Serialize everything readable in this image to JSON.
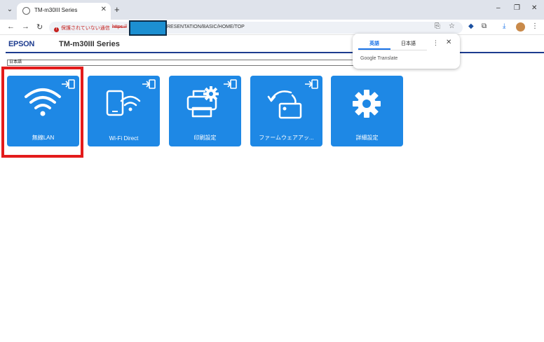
{
  "browser": {
    "tab_title": "TM-m30III Series",
    "security_label": "保護されていない通信",
    "url_protocol": "https://",
    "url_visible": "RESENTATION/BASIC/HOME/TOP",
    "tab_menu_glyph": "⌄",
    "new_tab_glyph": "+",
    "close_glyph": "✕",
    "minimize_glyph": "–",
    "maximize_glyph": "❐",
    "back_glyph": "←",
    "forward_glyph": "→",
    "reload_glyph": "↻",
    "translate_glyph": "⎘",
    "star_glyph": "☆",
    "ext1_glyph": "◆",
    "ext2_glyph": "⧉",
    "download_glyph": "⤓",
    "menu_glyph": "⋮"
  },
  "translate_popup": {
    "tab_source": "英語",
    "tab_target": "日本語",
    "more_glyph": "⋮",
    "close_glyph": "✕",
    "brand": "Google Translate"
  },
  "header": {
    "logo": "EPSON",
    "product": "TM-m30III Series"
  },
  "language_select": {
    "value": "日本語"
  },
  "tiles": [
    {
      "label": "無線LAN",
      "icon": "wifi-icon"
    },
    {
      "label": "Wi-Fi Direct",
      "icon": "wifi-direct-icon"
    },
    {
      "label": "印刷設定",
      "icon": "print-settings-icon"
    },
    {
      "label": "ファームウェアアッ...",
      "icon": "firmware-update-icon"
    },
    {
      "label": "詳細設定",
      "icon": "gear-icon"
    }
  ],
  "colors": {
    "tile": "#1e88e5",
    "highlight": "#e31b1b",
    "brand": "#1d3c8f",
    "insecure": "#c5221f"
  }
}
